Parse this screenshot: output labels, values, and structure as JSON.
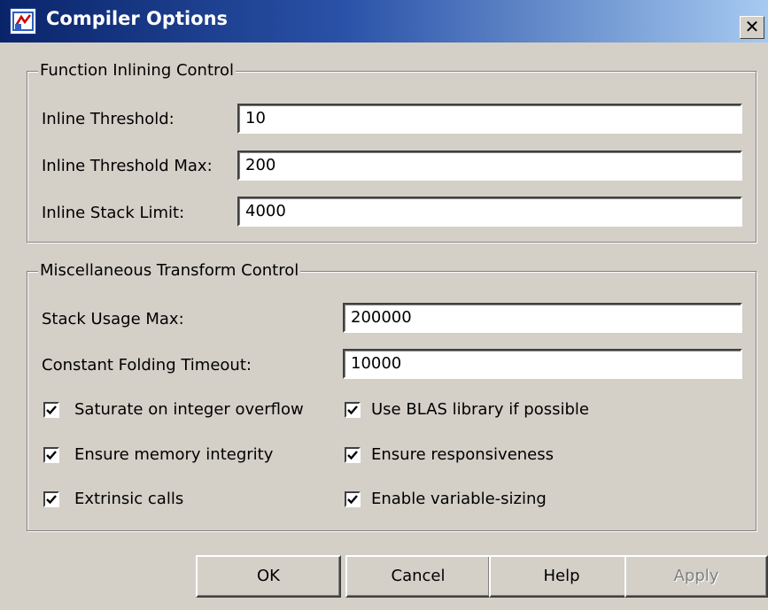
{
  "window": {
    "title": "Compiler Options",
    "close_glyph": "✕"
  },
  "inlining": {
    "legend": "Function Inlining Control",
    "fields": [
      {
        "label": "Inline Threshold:",
        "value": "10"
      },
      {
        "label": "Inline Threshold Max:",
        "value": "200"
      },
      {
        "label": "Inline Stack Limit:",
        "value": "4000"
      }
    ]
  },
  "misc": {
    "legend": "Miscellaneous Transform Control",
    "fields": [
      {
        "label": "Stack Usage Max:",
        "value": "200000"
      },
      {
        "label": "Constant Folding Timeout:",
        "value": "10000"
      }
    ],
    "checkboxes": [
      {
        "label": "Saturate on integer overflow",
        "checked": true
      },
      {
        "label": "Use BLAS library if possible",
        "checked": true
      },
      {
        "label": "Ensure memory integrity",
        "checked": true
      },
      {
        "label": "Ensure responsiveness",
        "checked": true
      },
      {
        "label": "Extrinsic calls",
        "checked": true
      },
      {
        "label": "Enable variable-sizing",
        "checked": true
      }
    ]
  },
  "buttons": {
    "ok": "OK",
    "cancel": "Cancel",
    "help": "Help",
    "apply": "Apply"
  },
  "colors": {
    "titlebar_start": "#0a246a",
    "titlebar_end": "#a6caf0",
    "face": "#d4d0c8"
  },
  "icons": {
    "app": "compiler-app-icon",
    "check": "checkmark-icon"
  }
}
